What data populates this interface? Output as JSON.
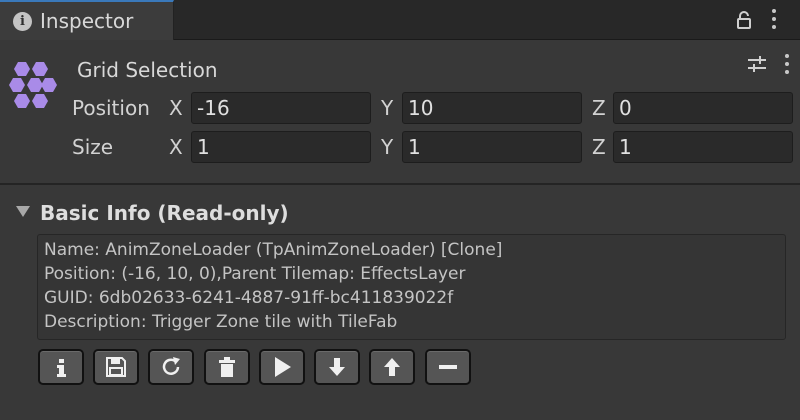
{
  "window": {
    "tab_title": "Inspector",
    "accent_color": "#3a79bb",
    "icons": [
      "info-icon",
      "lock-icon",
      "menu-dots-icon"
    ]
  },
  "header": {
    "title": "Grid Selection",
    "icon": "hexagon-grid-icon",
    "icon_color": "#a98be8"
  },
  "transform": {
    "position": {
      "label": "Position",
      "x_label": "X",
      "x": "-16",
      "y_label": "Y",
      "y": "10",
      "z_label": "Z",
      "z": "0"
    },
    "size": {
      "label": "Size",
      "x_label": "X",
      "x": "1",
      "y_label": "Y",
      "y": "1",
      "z_label": "Z",
      "z": "1"
    }
  },
  "basic_info": {
    "title": "Basic Info (Read-only)",
    "lines": [
      "Name: AnimZoneLoader (TpAnimZoneLoader) [Clone]",
      "Position: (-16, 10, 0),Parent Tilemap: EffectsLayer",
      "GUID: 6db02633-6241-4887-91ff-bc411839022f",
      "Description: Trigger Zone tile with TileFab"
    ]
  },
  "toolbar": {
    "buttons": [
      "info-icon",
      "save-icon",
      "refresh-icon",
      "delete-icon",
      "play-icon",
      "arrow-down-icon",
      "arrow-up-icon",
      "minus-icon"
    ]
  }
}
